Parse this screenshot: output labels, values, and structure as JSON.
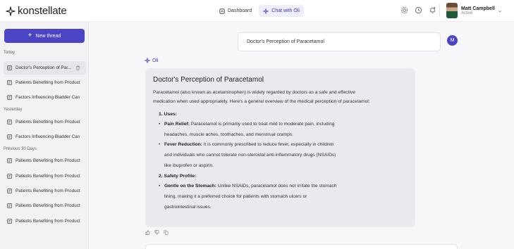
{
  "brand": {
    "name": "konstellate"
  },
  "nav": {
    "tabs": [
      {
        "label": "Dashboard"
      },
      {
        "label": "Chat with Oli"
      }
    ]
  },
  "user": {
    "name": "Matt Campbell",
    "status": "Active",
    "initial": "M"
  },
  "sidebar": {
    "new_thread_label": "New thread",
    "sections": [
      {
        "label": "Today",
        "items": [
          "Doctor's Perception of Par...",
          "Patients Benefiting from Product",
          "Factors Influencing Bladder Can"
        ]
      },
      {
        "label": "Yesterday",
        "items": [
          "Patients Benefiting from Product",
          "Factors Influencing Bladder Can"
        ]
      },
      {
        "label": "Previous 30 Days",
        "items": [
          "Patients Benefiting from Product",
          "Patients Benefiting from Product",
          "Patients Benefiting from Product",
          "Patients Benefiting from Product",
          "Patients Benefiting from Product"
        ]
      }
    ]
  },
  "chat": {
    "user_message": "Doctor's Perception of Paracetamol",
    "assistant_name": "Oli",
    "answer": {
      "title": "Doctor's Perception of Paracetamol",
      "intro_1": "Paracetamol (also known as acetaminophen) is widely regarded by doctors as a safe and effective",
      "intro_2": "medication when used appropriately. Here's a general overview of the medical perception of paracetamol:",
      "h1": "1. Uses:",
      "pain_bold": "Pain Relief:",
      "pain_1": " Paracetamol is primarily used to treat mild to moderate pain, including",
      "pain_2": "headaches, muscle aches, toothaches, and menstrual cramps.",
      "fever_bold": "Fever Reduction:",
      "fever_1": " It is commonly prescribed to reduce fever, especially in children",
      "fever_2": "and individuals who cannot tolerate non-steroidal anti-inflammatory drugs (NSAIDs)",
      "fever_3": "like ibuprofen or aspirin.",
      "h2": "2. Safety Profile:",
      "stomach_bold": "Gentle on the Stomach:",
      "stomach_1": " Unlike NSAIDs, paracetamol does not irritate the stomach",
      "stomach_2": "lining, making it a preferred choice for patients with stomach ulcers or",
      "stomach_3": "gastrointestinal issues."
    }
  },
  "colors": {
    "accent": "#4b45c6",
    "accent_text": "#3a35b8",
    "answer_bg": "#ebebef",
    "sidebar_bg": "#f2f2f5"
  }
}
